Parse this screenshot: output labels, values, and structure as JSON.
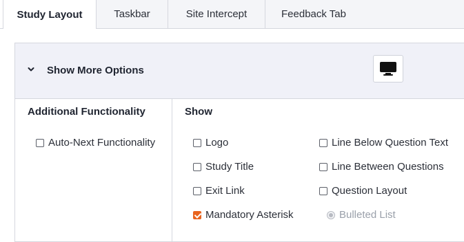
{
  "tabs": [
    {
      "label": "Study Layout",
      "active": true
    },
    {
      "label": "Taskbar",
      "active": false
    },
    {
      "label": "Site Intercept",
      "active": false
    },
    {
      "label": "Feedback Tab",
      "active": false
    }
  ],
  "options_panel": {
    "toggle_label": "Show More Options",
    "toggle_icon": "chevron-down-icon",
    "device_icon": "monitor-icon"
  },
  "additional_functionality": {
    "title": "Additional Functionality",
    "items": [
      {
        "label": "Auto-Next Functionality",
        "checked": false
      }
    ]
  },
  "show": {
    "title": "Show",
    "left_items": [
      {
        "label": "Logo",
        "checked": false
      },
      {
        "label": "Study Title",
        "checked": false
      },
      {
        "label": "Exit Link",
        "checked": false
      },
      {
        "label": "Mandatory Asterisk",
        "checked": true
      }
    ],
    "right_items": [
      {
        "label": "Line Below Question Text",
        "checked": false
      },
      {
        "label": "Line Between Questions",
        "checked": false
      },
      {
        "label": "Question Layout",
        "checked": false
      }
    ],
    "layout_radio": {
      "label": "Bulleted List",
      "selected": true,
      "disabled": true
    }
  },
  "colors": {
    "accent": "#e8641f",
    "panel_header_bg": "#f0f1f8",
    "border": "#d5d7de"
  }
}
